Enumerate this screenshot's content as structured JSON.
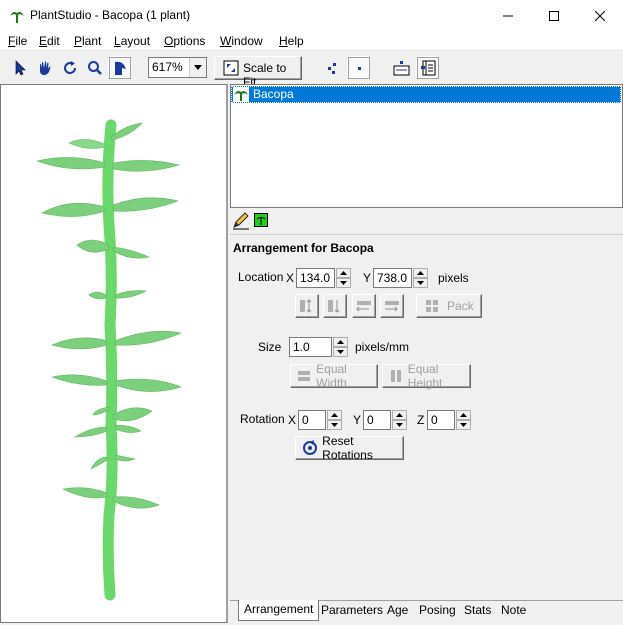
{
  "window": {
    "title": "PlantStudio - Bacopa (1 plant)"
  },
  "menu": {
    "items": [
      {
        "label": "File",
        "key": "F",
        "rest": "ile"
      },
      {
        "label": "Edit",
        "key": "E",
        "rest": "dit"
      },
      {
        "label": "Plant",
        "key": "P",
        "rest": "lant"
      },
      {
        "label": "Layout",
        "key": "L",
        "rest": "ayout"
      },
      {
        "label": "Options",
        "key": "O",
        "rest": "ptions"
      },
      {
        "label": "Window",
        "key": "W",
        "rest": "indow"
      },
      {
        "label": "Help",
        "key": "H",
        "rest": "elp"
      }
    ]
  },
  "toolbar": {
    "zoom_value": "617%",
    "scale_to_fit_label": "Scale to Fit",
    "active_tool": "rotate-pose-tool"
  },
  "plant_list": {
    "items": [
      {
        "name": "Bacopa",
        "selected": true
      }
    ]
  },
  "arrangement": {
    "title": "Arrangement for Bacopa",
    "location": {
      "label": "Location",
      "x_label": "X",
      "x_value": "134.0",
      "y_label": "Y",
      "y_value": "738.0",
      "units": "pixels"
    },
    "pack_label": "Pack",
    "size": {
      "label": "Size",
      "value": "1.0",
      "units": "pixels/mm"
    },
    "equal_width_label": "Equal Width",
    "equal_height_label": "Equal Height",
    "rotation": {
      "label": "Rotation",
      "x_label": "X",
      "x_value": "0",
      "y_label": "Y",
      "y_value": "0",
      "z_label": "Z",
      "z_value": "0"
    },
    "reset_rotations_label": "Reset Rotations"
  },
  "tabs": [
    {
      "label": "Arrangement",
      "active": true
    },
    {
      "label": "Parameters",
      "active": false
    },
    {
      "label": "Age",
      "active": false
    },
    {
      "label": "Posing",
      "active": false
    },
    {
      "label": "Stats",
      "active": false
    },
    {
      "label": "Note",
      "active": false
    }
  ],
  "colors": {
    "plant_leaf": "#7ccf7c",
    "plant_leaf_dark": "#5cb85c",
    "plant_stem": "#6ad86a",
    "selection": "#0078d7"
  }
}
